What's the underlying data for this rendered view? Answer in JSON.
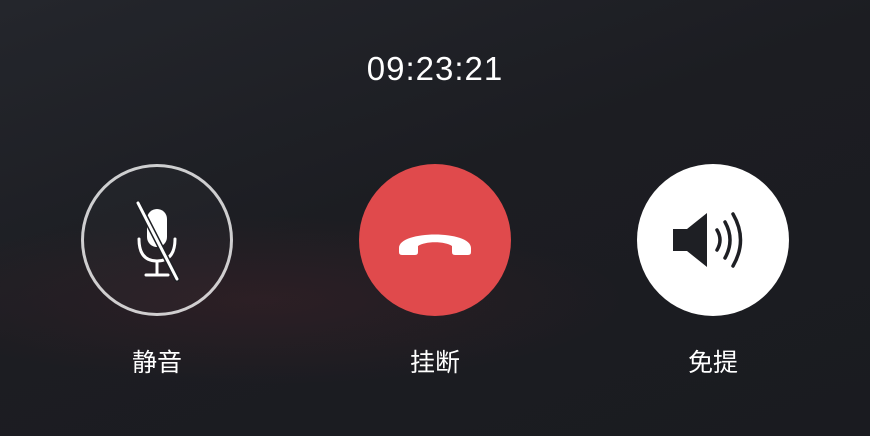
{
  "call": {
    "elapsed_time": "09:23:21"
  },
  "controls": {
    "mute": {
      "label": "静音",
      "icon": "mic-off-icon",
      "state": "off"
    },
    "hangup": {
      "label": "挂断",
      "icon": "phone-hangup-icon",
      "color": "#e04a4c"
    },
    "speaker": {
      "label": "免提",
      "icon": "speaker-icon",
      "state": "on"
    }
  },
  "colors": {
    "background": "#1c1d22",
    "hangup": "#e04a4c",
    "text": "#ffffff"
  }
}
